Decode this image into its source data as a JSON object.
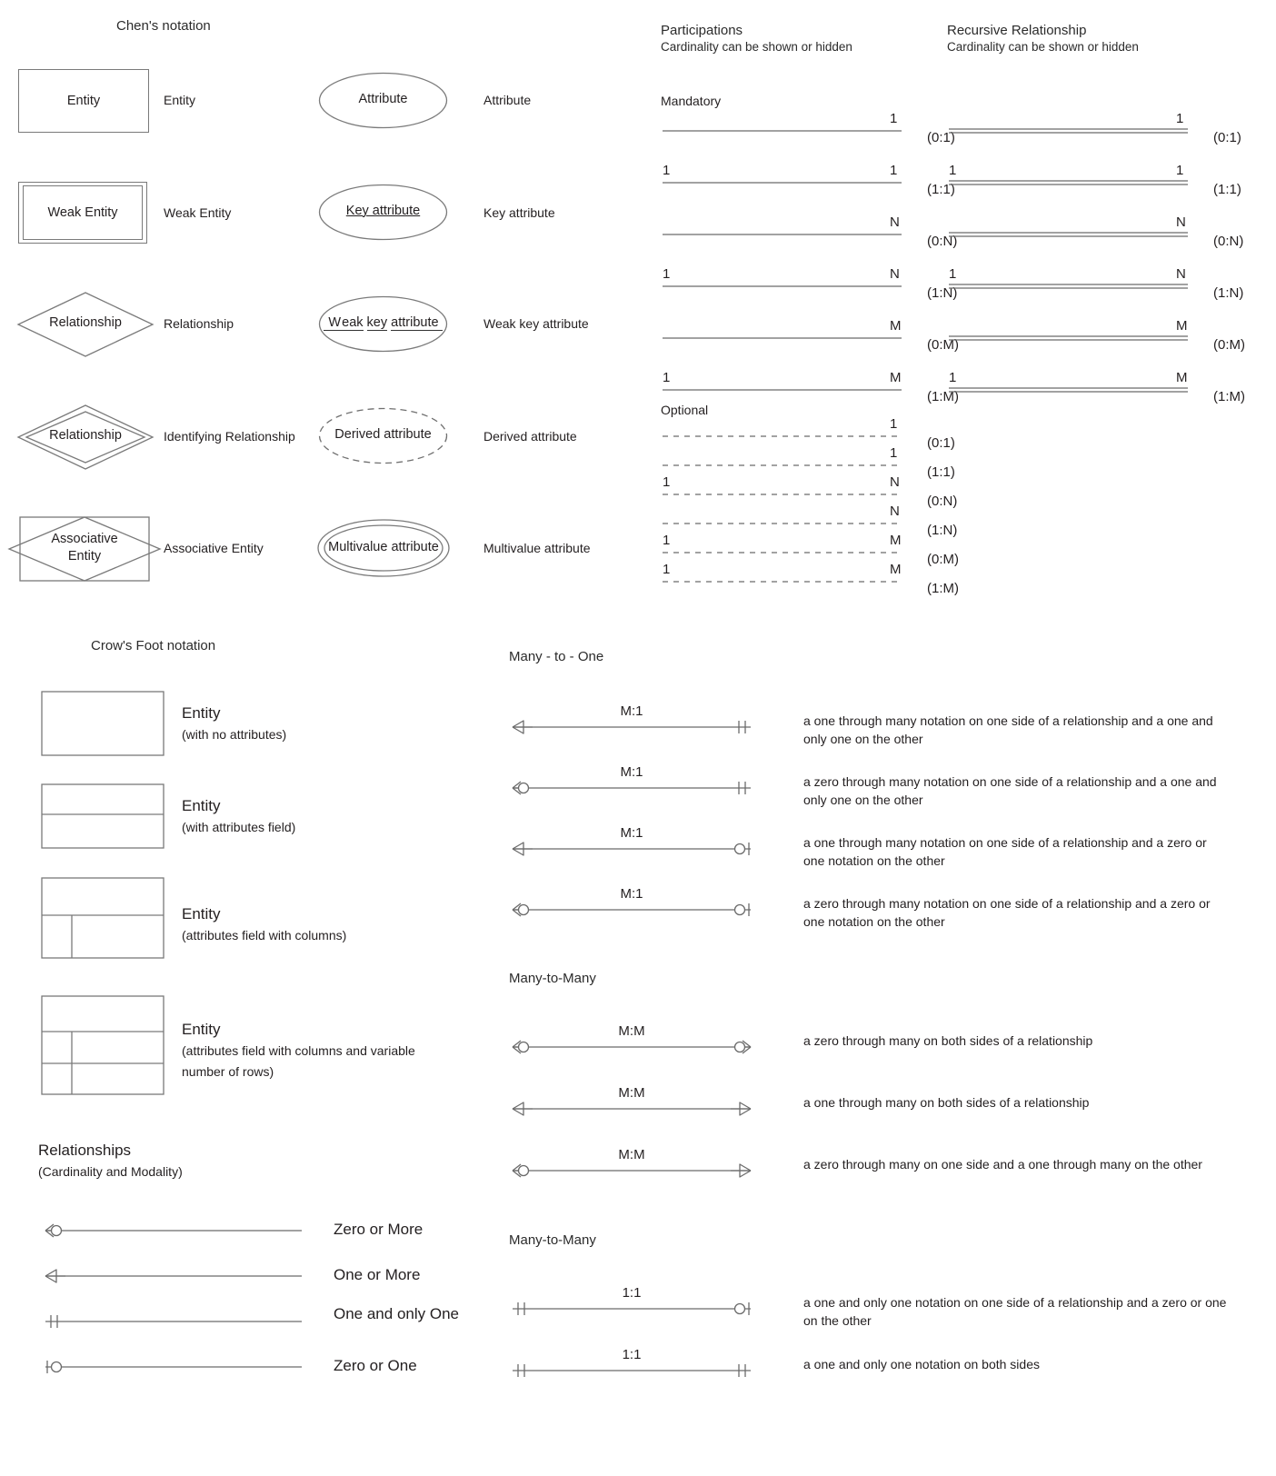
{
  "chen": {
    "title": "Chen's notation",
    "shapes_left": [
      {
        "shape": "Entity",
        "label": "Entity"
      },
      {
        "shape": "Weak Entity",
        "label": "Weak Entity"
      },
      {
        "shape": "Relationship",
        "label": "Relationship"
      },
      {
        "shape": "Relationship",
        "label": "Identifying Relationship"
      },
      {
        "shape": "Associative Entity",
        "label": "Associative Entity"
      }
    ],
    "shapes_right": [
      {
        "shape": "Attribute",
        "label": "Attribute"
      },
      {
        "shape": "Key attribute",
        "label": "Key attribute"
      },
      {
        "shape": "Weak key attribute",
        "label": "Weak key attribute"
      },
      {
        "shape": "Derived attribute",
        "label": "Derived attribute"
      },
      {
        "shape": "Multivalue attribute",
        "label": "Multivalue attribute"
      }
    ]
  },
  "participations": {
    "title": "Participations",
    "subtitle": "Cardinality can be shown or hidden",
    "mandatory_label": "Mandatory",
    "optional_label": "Optional",
    "mandatory_rows": [
      {
        "left": "",
        "right": "1",
        "card": "(0:1)"
      },
      {
        "left": "1",
        "right": "1",
        "card": "(1:1)"
      },
      {
        "left": "",
        "right": "N",
        "card": "(0:N)"
      },
      {
        "left": "1",
        "right": "N",
        "card": "(1:N)"
      },
      {
        "left": "",
        "right": "M",
        "card": "(0:M)"
      },
      {
        "left": "1",
        "right": "M",
        "card": "(1:M)"
      }
    ],
    "optional_rows": [
      {
        "left": "",
        "right": "1",
        "card": "(0:1)"
      },
      {
        "left": "",
        "right": "1",
        "card": "(1:1)"
      },
      {
        "left": "1",
        "right": "N",
        "card": "(0:N)"
      },
      {
        "left": "",
        "right": "N",
        "card": "(1:N)"
      },
      {
        "left": "1",
        "right": "M",
        "card": "(0:M)"
      },
      {
        "left": "1",
        "right": "M",
        "card": "(1:M)"
      }
    ]
  },
  "recursive": {
    "title": "Recursive Relationship",
    "subtitle": "Cardinality can be shown or hidden",
    "rows": [
      {
        "left": "",
        "right": "1",
        "card": "(0:1)"
      },
      {
        "left": "1",
        "right": "1",
        "card": "(1:1)"
      },
      {
        "left": "",
        "right": "N",
        "card": "(0:N)"
      },
      {
        "left": "1",
        "right": "N",
        "card": "(1:N)"
      },
      {
        "left": "",
        "right": "M",
        "card": "(0:M)"
      },
      {
        "left": "1",
        "right": "M",
        "card": "(1:M)"
      }
    ]
  },
  "crowsfoot": {
    "title": "Crow's Foot notation",
    "entities": [
      {
        "name": "Entity",
        "detail": "(with no attributes)"
      },
      {
        "name": "Entity",
        "detail": "(with attributes field)"
      },
      {
        "name": "Entity",
        "detail": "(attributes field with columns)"
      },
      {
        "name": "Entity",
        "detail": "(attributes field with columns and variable number of rows)"
      }
    ],
    "relationships_title": "Relationships",
    "relationships_subtitle": "(Cardinality and Modality)",
    "legend": [
      {
        "end": "zero-or-more",
        "label": "Zero or More"
      },
      {
        "end": "one-or-more",
        "label": "One or More"
      },
      {
        "end": "one-and-only-one",
        "label": "One and only One"
      },
      {
        "end": "zero-or-one",
        "label": "Zero or One"
      }
    ]
  },
  "many_to_one": {
    "title": "Many - to - One",
    "rows": [
      {
        "ratio": "M:1",
        "left_end": "one-or-more",
        "right_end": "one-and-only-one",
        "desc": "a one through many notation on one side of a relationship and a one and only one on the other"
      },
      {
        "ratio": "M:1",
        "left_end": "zero-or-more",
        "right_end": "one-and-only-one",
        "desc": "a zero through many notation on one side of a relationship and a one and only one on the other"
      },
      {
        "ratio": "M:1",
        "left_end": "one-or-more",
        "right_end": "zero-or-one",
        "desc": "a one through many notation on one side of a relationship and a zero or one notation on the other"
      },
      {
        "ratio": "M:1",
        "left_end": "zero-or-more",
        "right_end": "zero-or-one",
        "desc": "a zero through many notation on one side of a relationship and a zero or one notation on the other"
      }
    ]
  },
  "many_to_many": {
    "title": "Many-to-Many",
    "rows": [
      {
        "ratio": "M:M",
        "left_end": "zero-or-more",
        "right_end": "zero-or-more",
        "desc": "a zero through many on both sides of a relationship"
      },
      {
        "ratio": "M:M",
        "left_end": "one-or-more",
        "right_end": "one-or-more",
        "desc": "a one through many on both sides of a relationship"
      },
      {
        "ratio": "M:M",
        "left_end": "zero-or-more",
        "right_end": "one-or-more",
        "desc": "a zero through many on one side and a one through many on the other"
      }
    ]
  },
  "one_to_one": {
    "title": "Many-to-Many",
    "rows": [
      {
        "ratio": "1:1",
        "left_end": "one-and-only-one",
        "right_end": "zero-or-one",
        "desc": "a one and only one notation on one side of a relationship and a zero or one on the other"
      },
      {
        "ratio": "1:1",
        "left_end": "one-and-only-one",
        "right_end": "one-and-only-one",
        "desc": "a one and only one notation on both sides"
      }
    ]
  },
  "colors": {
    "stroke": "#7a7a7a",
    "line": "#6b6b6b",
    "text": "#231f20"
  }
}
